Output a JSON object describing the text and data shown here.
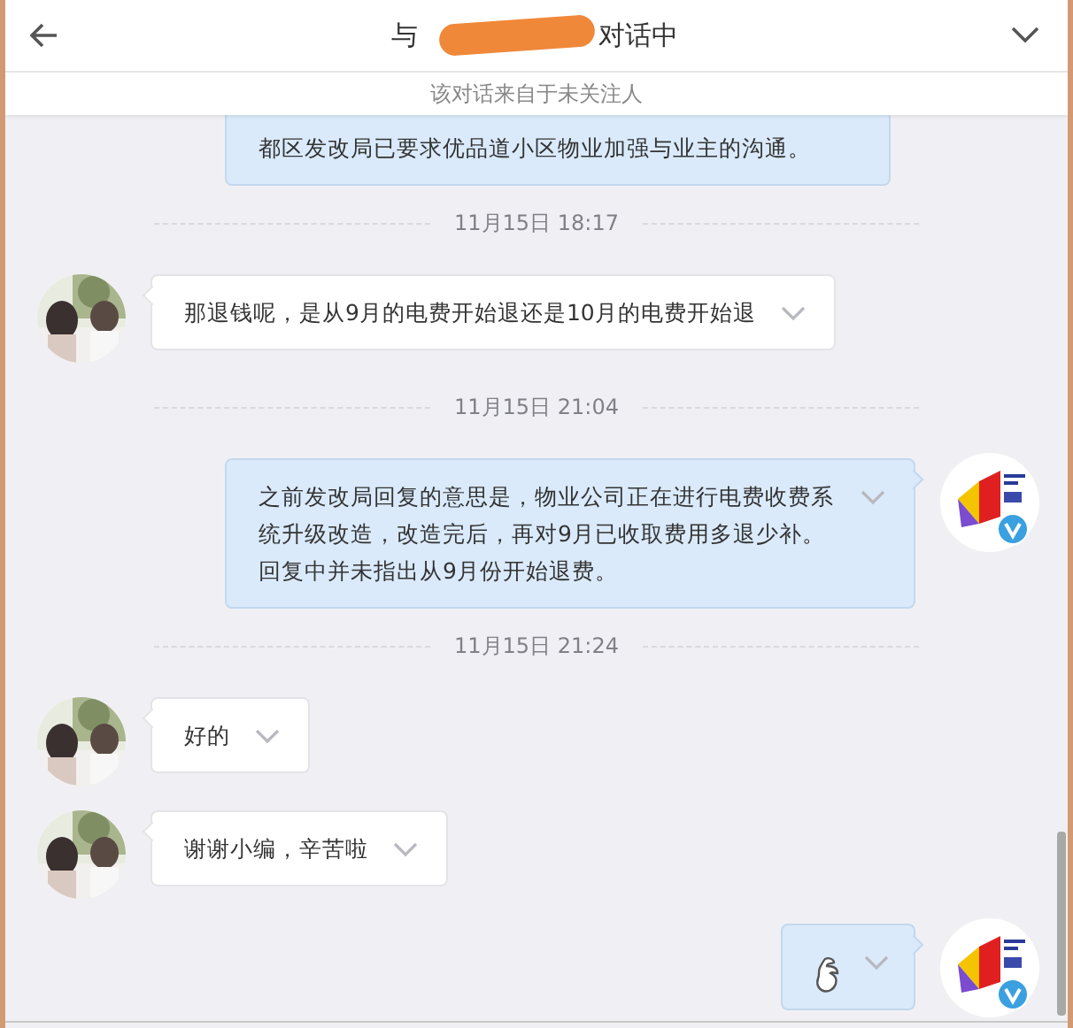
{
  "header": {
    "title_prefix": "与",
    "title_suffix": "对话中",
    "notice": "该对话来自于未关注人"
  },
  "items": [
    {
      "kind": "outgoing_cut",
      "text": "都区发改局已要求优品道小区物业加强与业主的沟通。"
    },
    {
      "kind": "time",
      "text": "11月15日 18:17"
    },
    {
      "kind": "incoming",
      "text": "那退钱呢，是从9月的电费开始退还是10月的电费开始退"
    },
    {
      "kind": "time",
      "text": "11月15日 21:04"
    },
    {
      "kind": "outgoing",
      "text": "之前发改局回复的意思是，物业公司正在进行电费收费系统升级改造，改造完后，再对9月已收取费用多退少补。回复中并未指出从9月份开始退费。"
    },
    {
      "kind": "time",
      "text": "11月15日 21:24"
    },
    {
      "kind": "incoming",
      "text": "好的"
    },
    {
      "kind": "incoming",
      "text": "谢谢小编，辛苦啦"
    },
    {
      "kind": "outgoing_emoji"
    }
  ]
}
